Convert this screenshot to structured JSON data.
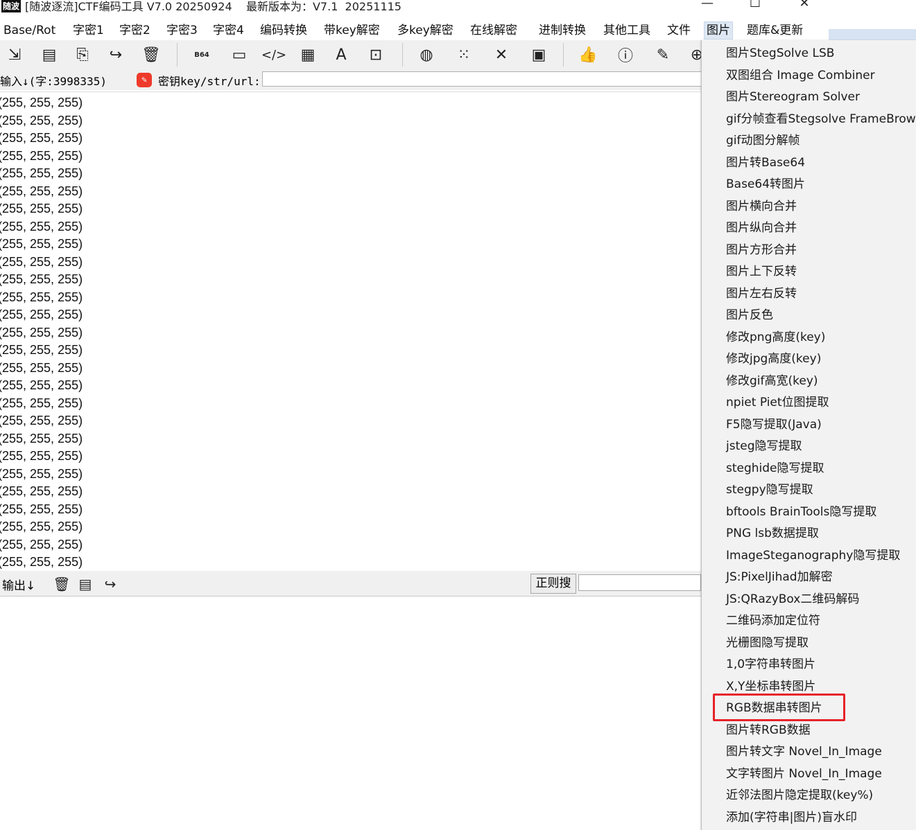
{
  "window": {
    "title": "[随波逐流]CTF编码工具 V7.0 20250924    最新版本为：V7.1  20251115",
    "icon_text": "随波",
    "minimize": "—",
    "maximize": "☐",
    "close": "✕"
  },
  "menubar": [
    {
      "label": "Base/Rot"
    },
    {
      "label": "字密1"
    },
    {
      "label": "字密2"
    },
    {
      "label": "字密3"
    },
    {
      "label": "字密4"
    },
    {
      "label": "编码转换"
    },
    {
      "label": "带key解密"
    },
    {
      "label": "多key解密"
    },
    {
      "label": "在线解密"
    },
    {
      "label": "进制转换"
    },
    {
      "label": "其他工具"
    },
    {
      "label": "文件"
    },
    {
      "label": "图片",
      "active": true
    },
    {
      "label": "题库&更新"
    }
  ],
  "toolbar": {
    "icons": [
      "import-icon",
      "copy-icon",
      "paste-icon",
      "share-icon",
      "trash-icon",
      "base64-icon",
      "terminal-icon",
      "code-icon",
      "table-icon",
      "font-icon",
      "edit-table-icon",
      "globe-icon",
      "grid-icon",
      "tools-icon",
      "document-icon",
      "thumbs-up-icon",
      "help-icon",
      "edit-icon",
      "up-icon"
    ]
  },
  "input": {
    "label": "输入↓(字:3998335)",
    "key_label": "密钥key/str/url:",
    "key_value": ""
  },
  "text_lines": [
    "(255, 255, 255)",
    "(255, 255, 255)",
    "(255, 255, 255)",
    "(255, 255, 255)",
    "(255, 255, 255)",
    "(255, 255, 255)",
    "(255, 255, 255)",
    "(255, 255, 255)",
    "(255, 255, 255)",
    "(255, 255, 255)",
    "(255, 255, 255)",
    "(255, 255, 255)",
    "(255, 255, 255)",
    "(255, 255, 255)",
    "(255, 255, 255)",
    "(255, 255, 255)",
    "(255, 255, 255)",
    "(255, 255, 255)",
    "(255, 255, 255)",
    "(255, 255, 255)",
    "(255, 255, 255)",
    "(255, 255, 255)",
    "(255, 255, 255)",
    "(255, 255, 255)",
    "(255, 255, 255)",
    "(255, 255, 255)",
    "(255, 255, 255)"
  ],
  "output": {
    "label": "输出↓",
    "regex_button": "正则搜",
    "regex_value": ""
  },
  "dropdown": {
    "items": [
      "图片StegSolve LSB",
      "双图组合 Image Combiner",
      "图片Stereogram Solver",
      "gif分帧查看Stegsolve FrameBrow",
      "gif动图分解帧",
      "图片转Base64",
      "Base64转图片",
      "图片横向合并",
      "图片纵向合并",
      "图片方形合并",
      "图片上下反转",
      "图片左右反转",
      "图片反色",
      "修改png高度(key)",
      "修改jpg高度(key)",
      "修改gif高宽(key)",
      "npiet Piet位图提取",
      "F5隐写提取(Java)",
      "jsteg隐写提取",
      "steghide隐写提取",
      "stegpy隐写提取",
      "bftools BrainTools隐写提取",
      "PNG lsb数据提取",
      "ImageSteganography隐写提取",
      "JS:PixelJihad加解密",
      "JS:QRazyBox二维码解码",
      "二维码添加定位符",
      "光栅图隐写提取",
      "1,0字符串转图片",
      "X,Y坐标串转图片",
      "RGB数据串转图片",
      "图片转RGB数据",
      "图片转文字 Novel_In_Image",
      "文字转图片 Novel_In_Image",
      "近邻法图片隐定提取(key%)",
      "添加(字符串|图片)盲水印"
    ],
    "highlighted": "RGB数据串转图片"
  },
  "colors": {
    "highlight": "#e8222a",
    "menu_bg": "#f2f2f2",
    "key_icon": "#ee3a2a"
  }
}
